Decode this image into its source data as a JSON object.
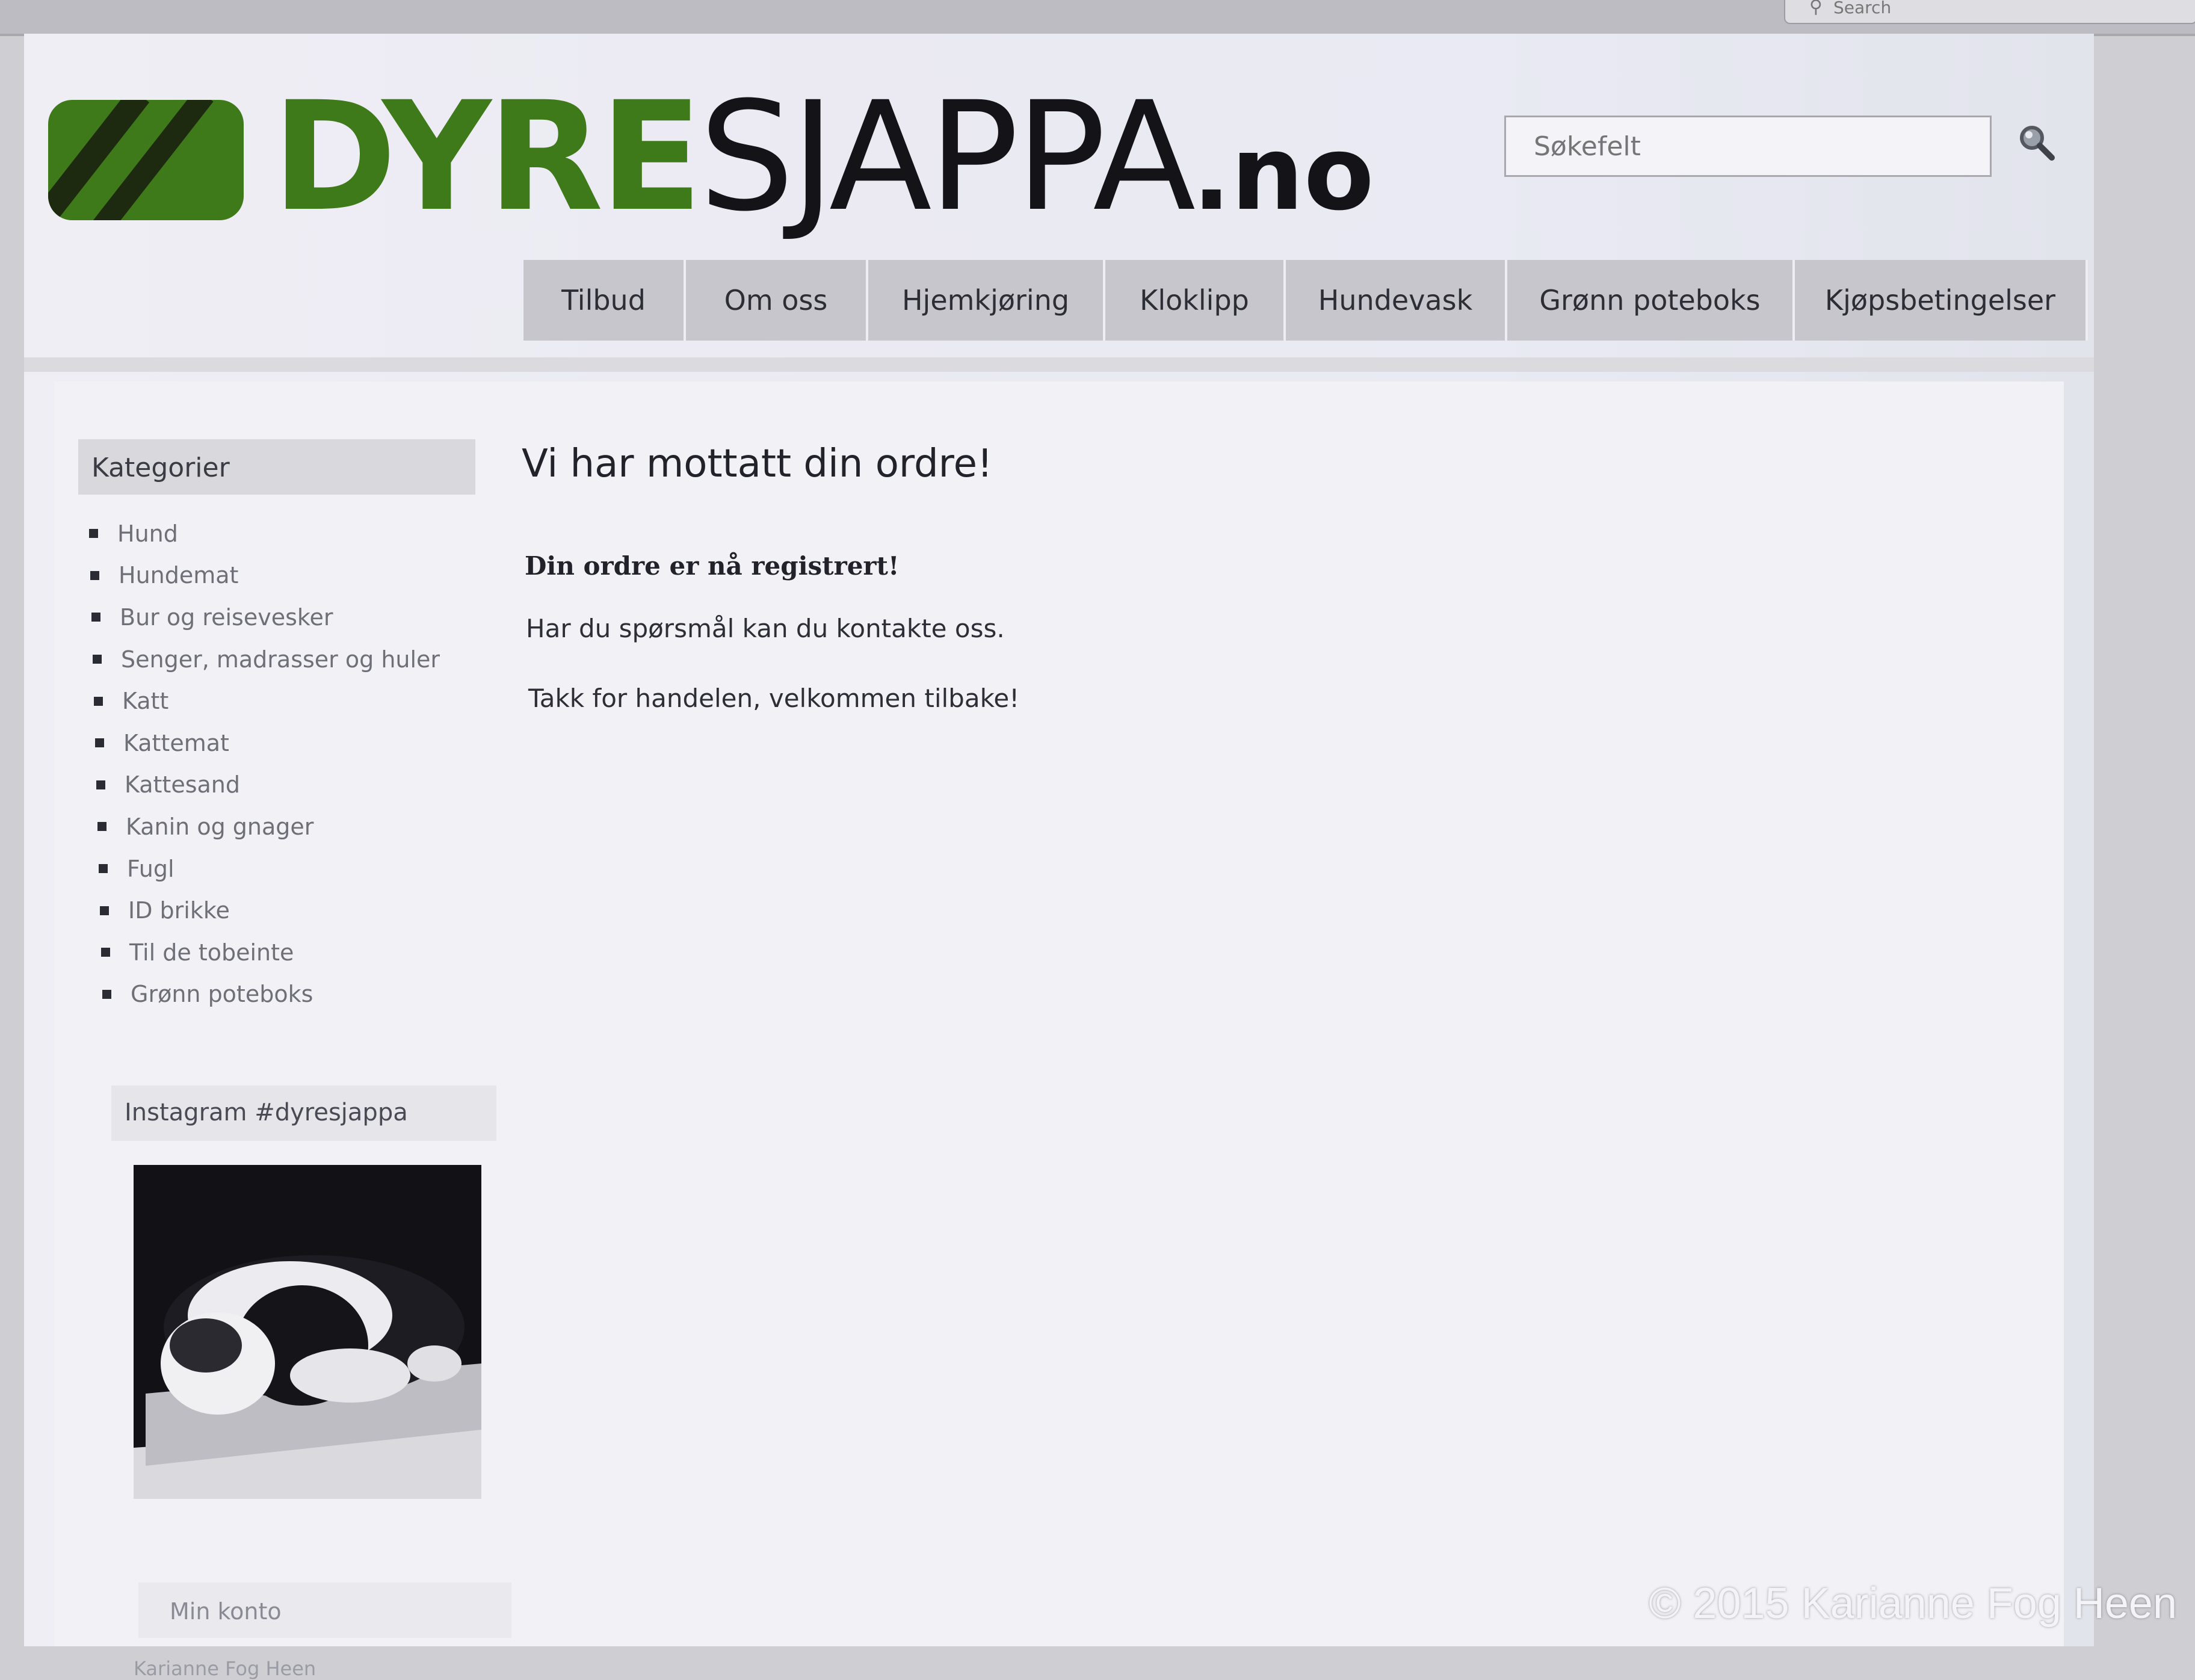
{
  "browser": {
    "search_label": "Search"
  },
  "header": {
    "logo": {
      "part1": "DYRE",
      "part2": "SJAPPA",
      "tld": ".no"
    },
    "search": {
      "placeholder": "Søkefelt"
    }
  },
  "nav": {
    "items": [
      {
        "label": "Tilbud"
      },
      {
        "label": "Om oss"
      },
      {
        "label": "Hjemkjøring"
      },
      {
        "label": "Kloklipp"
      },
      {
        "label": "Hundevask"
      },
      {
        "label": "Grønn poteboks"
      },
      {
        "label": "Kjøpsbetingelser"
      }
    ]
  },
  "sidebar": {
    "categories_title": "Kategorier",
    "categories": [
      "Hund",
      "Hundemat",
      "Bur og reisevesker",
      "Senger, madrasser og huler",
      "Katt",
      "Kattemat",
      "Kattesand",
      "Kanin og gnager",
      "Fugl",
      "ID brikke",
      "Til de tobeinte",
      "Grønn poteboks"
    ],
    "instagram_title": "Instagram #dyresjappa",
    "account_title": "Min konto",
    "account_user": "Karianne Fog Heen"
  },
  "main": {
    "title": "Vi har mottatt din ordre!",
    "bold_line": "Din ordre er nå registrert!",
    "line1": "Har du spørsmål kan du kontakte oss.",
    "line2": "Takk for handelen, velkommen tilbake!"
  },
  "watermark": "© 2015 Karianne Fog Heen",
  "colors": {
    "brand_green": "#3f7a1a",
    "nav_bg": "#c6c6cc"
  },
  "icons": {
    "search": "magnifier-icon"
  }
}
